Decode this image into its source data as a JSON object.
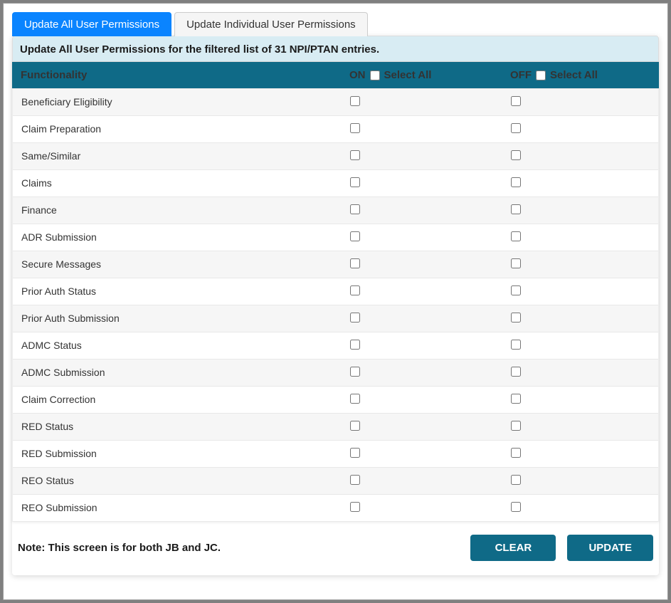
{
  "tabs": [
    {
      "label": "Update All User Permissions",
      "active": true
    },
    {
      "label": "Update Individual User Permissions",
      "active": false
    }
  ],
  "banner": "Update All User Permissions for the filtered list of 31 NPI/PTAN entries.",
  "table": {
    "header": {
      "functionality": "Functionality",
      "on": "ON",
      "off": "OFF",
      "select_all_on": "Select All",
      "select_all_off": "Select All"
    },
    "rows": [
      {
        "name": "Beneficiary Eligibility",
        "on": false,
        "off": false
      },
      {
        "name": "Claim Preparation",
        "on": false,
        "off": false
      },
      {
        "name": "Same/Similar",
        "on": false,
        "off": false
      },
      {
        "name": "Claims",
        "on": false,
        "off": false
      },
      {
        "name": "Finance",
        "on": false,
        "off": false
      },
      {
        "name": "ADR Submission",
        "on": false,
        "off": false
      },
      {
        "name": "Secure Messages",
        "on": false,
        "off": false
      },
      {
        "name": "Prior Auth Status",
        "on": false,
        "off": false
      },
      {
        "name": "Prior Auth Submission",
        "on": false,
        "off": false
      },
      {
        "name": "ADMC Status",
        "on": false,
        "off": false
      },
      {
        "name": "ADMC Submission",
        "on": false,
        "off": false
      },
      {
        "name": "Claim Correction",
        "on": false,
        "off": false
      },
      {
        "name": "RED Status",
        "on": false,
        "off": false
      },
      {
        "name": "RED Submission",
        "on": false,
        "off": false
      },
      {
        "name": "REO Status",
        "on": false,
        "off": false
      },
      {
        "name": "REO Submission",
        "on": false,
        "off": false
      }
    ]
  },
  "footer": {
    "note": "Note: This screen is for both JB and JC.",
    "clear_label": "CLEAR",
    "update_label": "UPDATE"
  }
}
